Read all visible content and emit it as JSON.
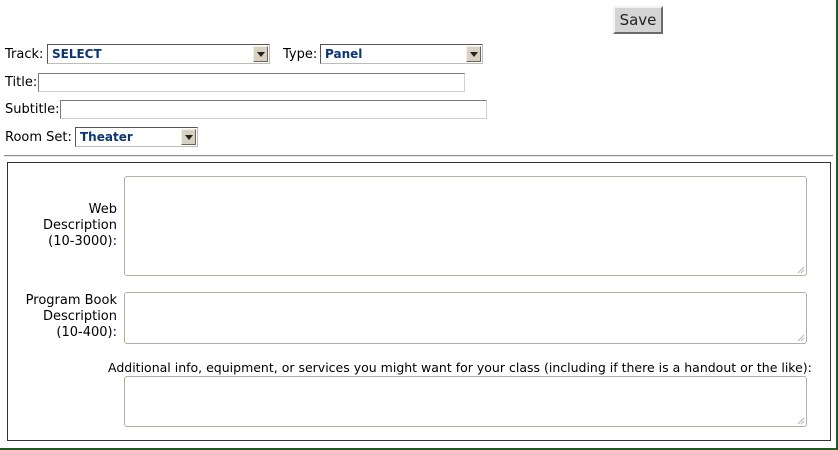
{
  "toolbar": {
    "save_label": "Save"
  },
  "form": {
    "track": {
      "label": "Track:",
      "selected": "SELECT"
    },
    "type": {
      "label": "Type:",
      "selected": "Panel"
    },
    "title": {
      "label": "Title:",
      "value": ""
    },
    "subtitle": {
      "label": "Subtitle:",
      "value": ""
    },
    "room_set": {
      "label": "Room Set:",
      "selected": "Theater"
    }
  },
  "descriptions": {
    "web": {
      "label_lines": [
        "Web",
        "Description",
        "(10-3000):"
      ],
      "value": ""
    },
    "program_book": {
      "label_lines": [
        "Program Book",
        "Description",
        "(10-400):"
      ],
      "value": ""
    },
    "additional": {
      "label": "Additional info, equipment, or services you might want for your class (including if there is a handout or the like):",
      "value": ""
    }
  },
  "colors": {
    "frame": "#1f5a1f",
    "select_text": "#0a3673"
  },
  "icons": {
    "select_arrow": "chevron-down-icon",
    "resize_grip": "resize-grip-icon"
  }
}
